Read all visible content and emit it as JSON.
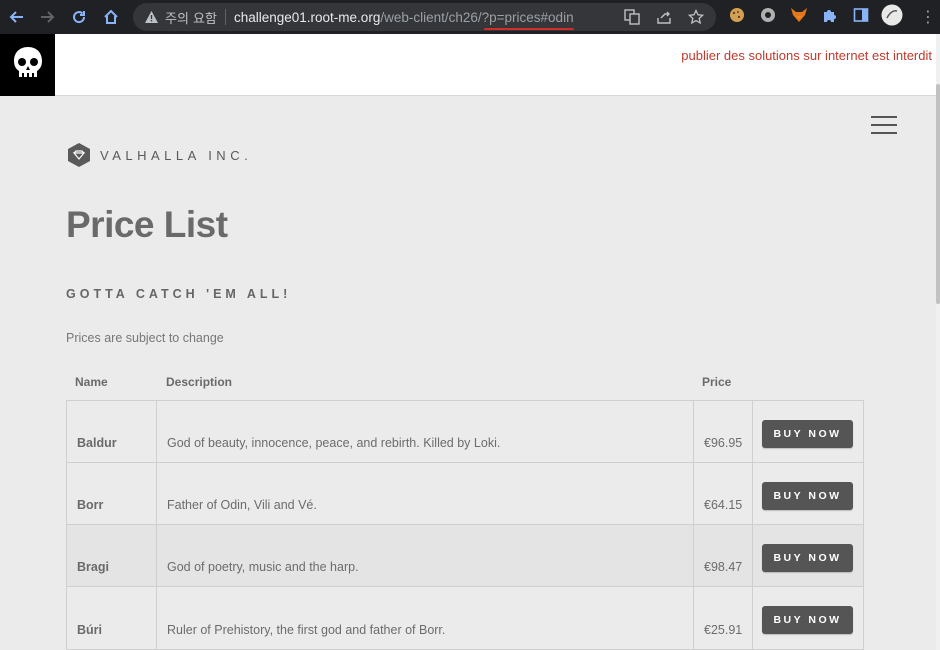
{
  "browser": {
    "omni_label": "주의 요함",
    "url_host": "challenge01.root-me.org",
    "url_path": "/web-client/ch26/?p=prices#odin",
    "icons": [
      "back-icon",
      "forward-icon",
      "reload-icon",
      "home-icon",
      "warning-icon",
      "translate-icon",
      "share-icon",
      "star-icon",
      "cookie-icon",
      "extension-gear-icon",
      "fox-icon",
      "puzzle-icon",
      "sidebar-icon",
      "profile-icon",
      "menu-dots-icon"
    ]
  },
  "banner": {
    "notice": "publier des solutions sur internet est interdit",
    "notice_color": "#c0392b"
  },
  "site": {
    "brand": "VALHALLA INC.",
    "title": "Price List",
    "subtitle": "GOTTA CATCH 'EM ALL!",
    "note": "Prices are subject to change"
  },
  "table": {
    "headers": {
      "name": "Name",
      "description": "Description",
      "price": "Price"
    },
    "rows": [
      {
        "name": "Baldur",
        "description": "God of beauty, innocence, peace, and rebirth. Killed by Loki.",
        "price": "€96.95",
        "action": "BUY NOW"
      },
      {
        "name": "Borr",
        "description": "Father of Odin, Vili and Vé.",
        "price": "€64.15",
        "action": "BUY NOW"
      },
      {
        "name": "Bragi",
        "description": "God of poetry, music and the harp.",
        "price": "€98.47",
        "action": "BUY NOW"
      },
      {
        "name": "Búri",
        "description": "Ruler of Prehistory, the first god and father of Borr.",
        "price": "€25.91",
        "action": "BUY NOW"
      }
    ]
  }
}
